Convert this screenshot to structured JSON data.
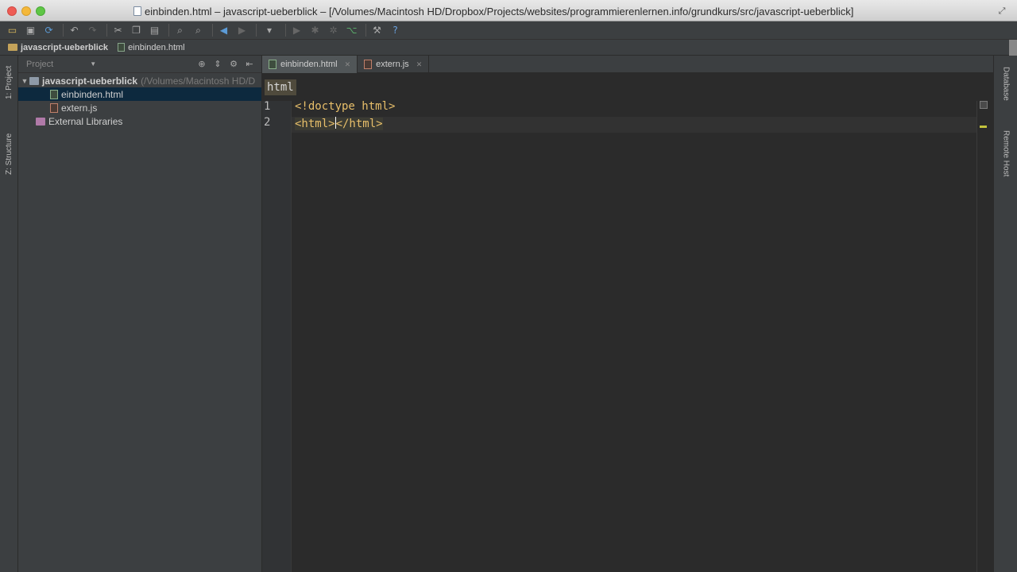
{
  "window": {
    "title": "einbinden.html – javascript-ueberblick – [/Volumes/Macintosh HD/Dropbox/Projects/websites/programmierenlernen.info/grundkurs/src/javascript-ueberblick]"
  },
  "toolbar": {
    "icons": [
      "open-folder-icon",
      "save-icon",
      "sync-icon",
      "undo-icon",
      "redo-icon",
      "cut-icon",
      "copy-icon",
      "paste-icon",
      "find-icon",
      "replace-icon",
      "back-icon",
      "forward-icon",
      "run-config-dropdown-icon",
      "run-icon",
      "debug-icon",
      "coverage-icon",
      "vcs-icon",
      "settings-icon",
      "help-icon"
    ]
  },
  "navbar": {
    "crumbs": [
      "javascript-ueberblick",
      "einbinden.html"
    ]
  },
  "left_strip": {
    "project_tab": "1: Project",
    "structure_tab": "Z: Structure"
  },
  "project_panel": {
    "header": "Project",
    "tree": [
      {
        "label": "javascript-ueberblick",
        "path": "(/Volumes/Macintosh HD/D",
        "type": "folder"
      },
      {
        "label": "einbinden.html",
        "type": "html",
        "selected": true
      },
      {
        "label": "extern.js",
        "type": "js"
      },
      {
        "label": "External Libraries",
        "type": "library"
      }
    ]
  },
  "editor": {
    "tabs": [
      {
        "label": "einbinden.html",
        "active": true
      },
      {
        "label": "extern.js",
        "active": false
      }
    ],
    "breadcrumb": "html",
    "line_numbers": [
      "1",
      "2"
    ],
    "lines": {
      "l1": "<!doctype html>",
      "l2_open": "<html>",
      "l2_close": "</html>"
    }
  },
  "right_strip": {
    "database_tab": "Database",
    "remote_tab": "Remote Host"
  },
  "colors": {
    "editor_bg": "#2b2b2b",
    "panel_bg": "#3c3f41",
    "tag_color": "#e8bf6a",
    "selection": "#0d293e"
  }
}
